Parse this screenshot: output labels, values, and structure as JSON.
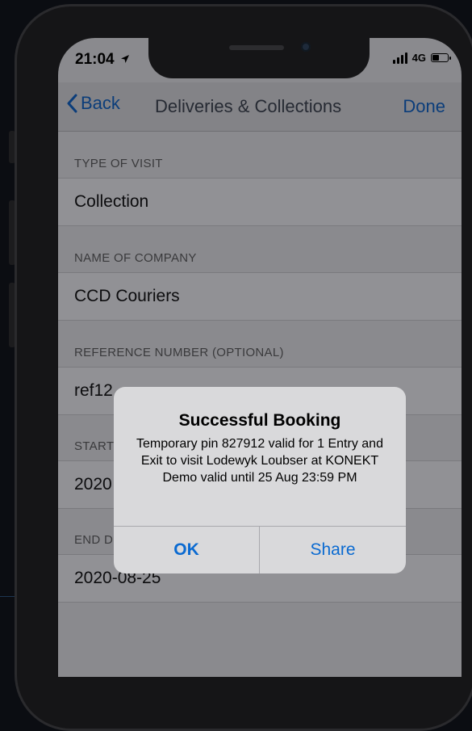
{
  "status_bar": {
    "time": "21:04",
    "network": "4G"
  },
  "nav": {
    "back_label": "Back",
    "title": "Deliveries & Collections",
    "done_label": "Done"
  },
  "form": {
    "type_of_visit": {
      "header": "TYPE OF VISIT",
      "value": "Collection"
    },
    "company": {
      "header": "NAME OF COMPANY",
      "value": "CCD Couriers"
    },
    "reference": {
      "header": "REFERENCE NUMBER (OPTIONAL)",
      "value": "ref12"
    },
    "start": {
      "header": "START",
      "value": "2020"
    },
    "end": {
      "header": "END D",
      "value": "2020-08-25"
    }
  },
  "alert": {
    "title": "Successful Booking",
    "message": "Temporary pin 827912 valid for 1 Entry and Exit to visit Lodewyk Loubser at KONEKT Demo valid until 25 Aug 23:59 PM",
    "ok_label": "OK",
    "share_label": "Share"
  },
  "colors": {
    "accent": "#0a6ad1",
    "nav_tint": "#0b3d7a"
  }
}
